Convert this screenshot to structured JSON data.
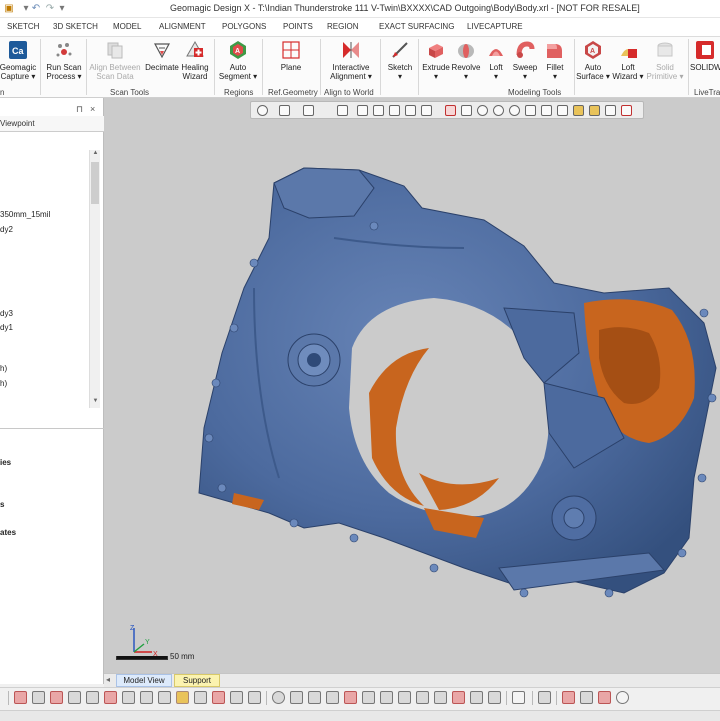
{
  "window": {
    "title": "Geomagic Design X - T:\\Indian Thunderstroke 111 V-Twin\\BXXXX\\CAD Outgoing\\Body\\Body.xrl - [NOT FOR RESALE]"
  },
  "menu": {
    "tabs": [
      "SKETCH",
      "3D SKETCH",
      "MODEL",
      "ALIGNMENT",
      "POLYGONS",
      "POINTS",
      "REGION",
      "EXACT SURFACING",
      "LIVECAPTURE"
    ]
  },
  "ribbon": {
    "buttons": {
      "geomagic_capture": [
        "Geomagic",
        "Capture ▾"
      ],
      "run_scan_process": [
        "Run Scan",
        "Process ▾"
      ],
      "align_between_scan_data": [
        "Align Between",
        "Scan Data"
      ],
      "decimate": [
        "Decimate",
        ""
      ],
      "healing_wizard": [
        "Healing",
        "Wizard"
      ],
      "auto_segment": [
        "Auto",
        "Segment ▾"
      ],
      "plane": [
        "Plane",
        ""
      ],
      "interactive_alignment": [
        "Interactive",
        "Alignment ▾"
      ],
      "sketch": [
        "Sketch",
        "▾"
      ],
      "extrude": [
        "Extrude",
        "▾"
      ],
      "revolve": [
        "Revolve",
        "▾"
      ],
      "loft": [
        "Loft",
        "▾"
      ],
      "sweep": [
        "Sweep",
        "▾"
      ],
      "fillet": [
        "Fillet",
        "▾"
      ],
      "auto_surface": [
        "Auto",
        "Surface ▾"
      ],
      "loft_wizard": [
        "Loft",
        "Wizard ▾"
      ],
      "solid_primitive": [
        "Solid",
        "Primitive ▾"
      ],
      "solidworks": [
        "SOLIDW",
        ""
      ]
    },
    "groups": {
      "first": "n",
      "scan_tools": "Scan Tools",
      "regions": "Regions",
      "ref_geometry": "Ref.Geometry",
      "align_to_world": "Align to World",
      "modeling_tools": "Modeling Tools",
      "livetra": "LiveTra"
    }
  },
  "left_panel": {
    "pin_icon": "⊓",
    "close_icon": "×",
    "tab_label": "Viewpoint",
    "tree_items": [
      "350mm_15mil",
      "dy2",
      "dy3",
      "dy1",
      "h)",
      "h)"
    ],
    "bottom_items": [
      "ies",
      "s",
      "ates"
    ]
  },
  "viewport": {
    "scale_label": "50 mm",
    "axis_labels": {
      "z": "Z",
      "x": "X",
      "y": "Y"
    }
  },
  "bottom_tabs": {
    "model_view": "Model View",
    "support": "Support"
  },
  "colors": {
    "model_blue": "#4c6a9e",
    "model_orange": "#c8651e",
    "viewport_bg": "#cbcbcb"
  }
}
